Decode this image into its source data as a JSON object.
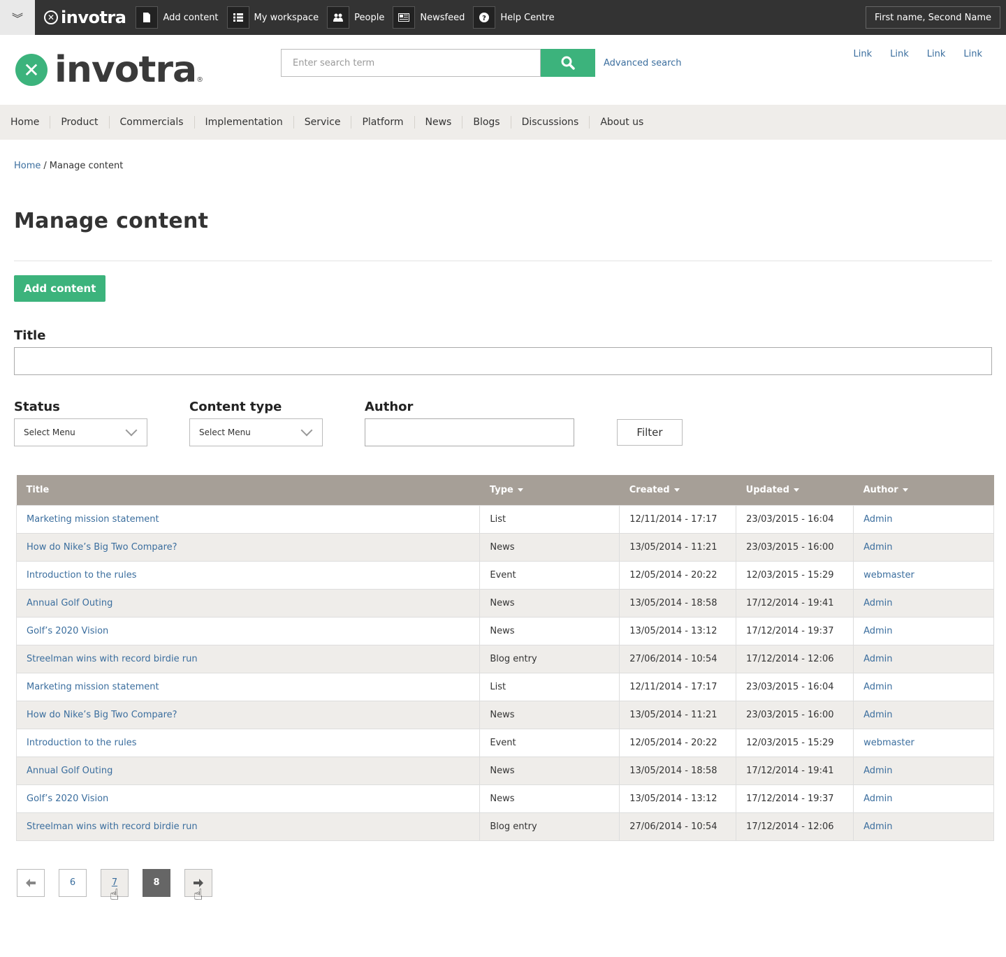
{
  "toolbar": {
    "logo": "invotra",
    "items": [
      {
        "label": "Add content"
      },
      {
        "label": "My workspace"
      },
      {
        "label": "People"
      },
      {
        "label": "Newsfeed"
      },
      {
        "label": "Help Centre"
      }
    ],
    "user": "First name, Second Name"
  },
  "header": {
    "brand": "invotra",
    "search_placeholder": "Enter search term",
    "advanced_search": "Advanced search",
    "links": [
      "Link",
      "Link",
      "Link",
      "Link"
    ]
  },
  "nav": [
    "Home",
    "Product",
    "Commercials",
    "Implementation",
    "Service",
    "Platform",
    "News",
    "Blogs",
    "Discussions",
    "About us"
  ],
  "breadcrumb": {
    "home": "Home",
    "sep": "/",
    "current": "Manage content"
  },
  "page_title": "Manage content",
  "add_button": "Add content",
  "form": {
    "title_label": "Title",
    "status_label": "Status",
    "status_value": "Select Menu",
    "type_label": "Content type",
    "type_value": "Select Menu",
    "author_label": "Author",
    "filter_button": "Filter"
  },
  "table": {
    "headers": [
      "Title",
      "Type",
      "Created",
      "Updated",
      "Author"
    ],
    "rows": [
      [
        "Marketing mission statement",
        "List",
        "12/11/2014  - 17:17",
        "23/03/2015  - 16:04",
        "Admin"
      ],
      [
        "How do Nike’s Big Two Compare?",
        "News",
        "13/05/2014  - 11:21",
        "23/03/2015  - 16:00",
        "Admin"
      ],
      [
        "Introduction to the rules",
        "Event",
        "12/05/2014 - 20:22",
        "12/03/2015 - 15:29",
        "webmaster"
      ],
      [
        "Annual Golf Outing",
        "News",
        "13/05/2014 - 18:58",
        "17/12/2014 - 19:41",
        "Admin"
      ],
      [
        "Golf’s 2020 Vision",
        "News",
        "13/05/2014 - 13:12",
        "17/12/2014 - 19:37",
        "Admin"
      ],
      [
        "Streelman wins with record birdie run",
        "Blog entry",
        "27/06/2014 - 10:54",
        "17/12/2014 - 12:06",
        "Admin"
      ],
      [
        "Marketing mission statement",
        "List",
        "12/11/2014  - 17:17",
        "23/03/2015  - 16:04",
        "Admin"
      ],
      [
        "How do Nike’s Big Two Compare?",
        "News",
        "13/05/2014  - 11:21",
        "23/03/2015  - 16:00",
        "Admin"
      ],
      [
        "Introduction to the rules",
        "Event",
        "12/05/2014 - 20:22",
        "12/03/2015 - 15:29",
        "webmaster"
      ],
      [
        "Annual Golf Outing",
        "News",
        "13/05/2014 - 18:58",
        "17/12/2014 - 19:41",
        "Admin"
      ],
      [
        "Golf’s 2020 Vision",
        "News",
        "13/05/2014 - 13:12",
        "17/12/2014 - 19:37",
        "Admin"
      ],
      [
        "Streelman wins with record birdie run",
        "Blog entry",
        "27/06/2014 - 10:54",
        "17/12/2014 - 12:06",
        "Admin"
      ]
    ]
  },
  "pager": {
    "pages": [
      "6",
      "7",
      "8"
    ],
    "current": "8"
  },
  "colors": {
    "accent": "#3cb37c",
    "link": "#3b6e9e",
    "toolbar": "#333333",
    "table_header": "#a69f97",
    "stripe": "#efedea"
  }
}
